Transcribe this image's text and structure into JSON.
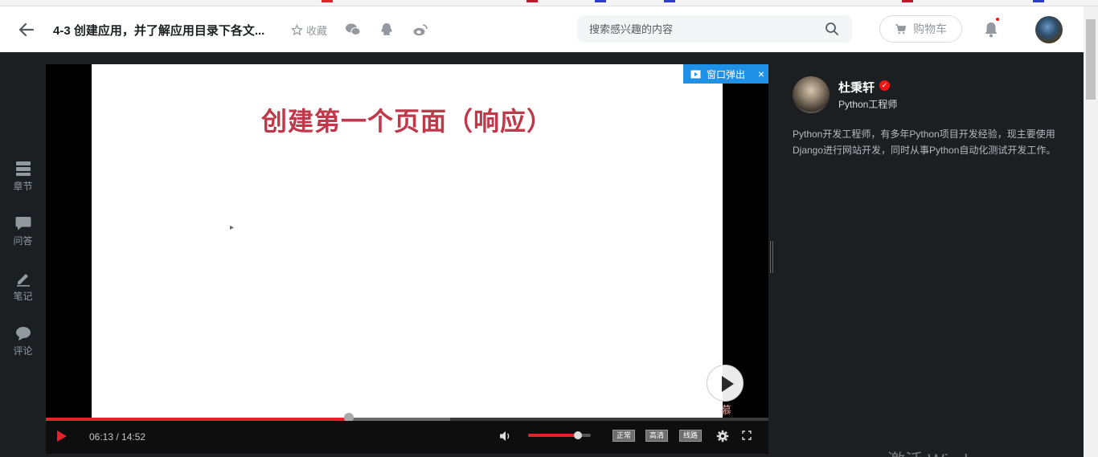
{
  "header": {
    "course_title": "4-3 创建应用，并了解应用目录下各文...",
    "favorite_label": "收藏",
    "search_placeholder": "搜索感兴趣的内容",
    "cart_label": "购物车"
  },
  "rail": {
    "items": [
      {
        "label": "章节",
        "icon": "chapters-icon"
      },
      {
        "label": "问答",
        "icon": "qa-icon"
      },
      {
        "label": "笔记",
        "icon": "notes-icon"
      },
      {
        "label": "评论",
        "icon": "comments-icon"
      }
    ]
  },
  "video": {
    "popout_label": "窗口弹出",
    "popout_close": "×",
    "slide_title": "创建第一个页面（响应）",
    "watermark": "慕课网",
    "time_display": "06:13 / 14:52",
    "progress_fraction": 0.4197,
    "buffered_fraction": 0.56,
    "volume_fraction": 0.8,
    "quality_buttons": [
      "正常",
      "高清",
      "线路"
    ]
  },
  "teacher": {
    "name": "杜秉轩",
    "role": "Python工程师",
    "bio": "Python开发工程师，有多年Python项目开发经验，现主要使用Django进行网站开发，同时从事Python自动化测试开发工作。"
  },
  "os_watermark": "激活 Windows",
  "colors": {
    "accent_red": "#e4232a",
    "popout_blue": "#1e90e6",
    "slide_title_red": "#c0394b"
  }
}
